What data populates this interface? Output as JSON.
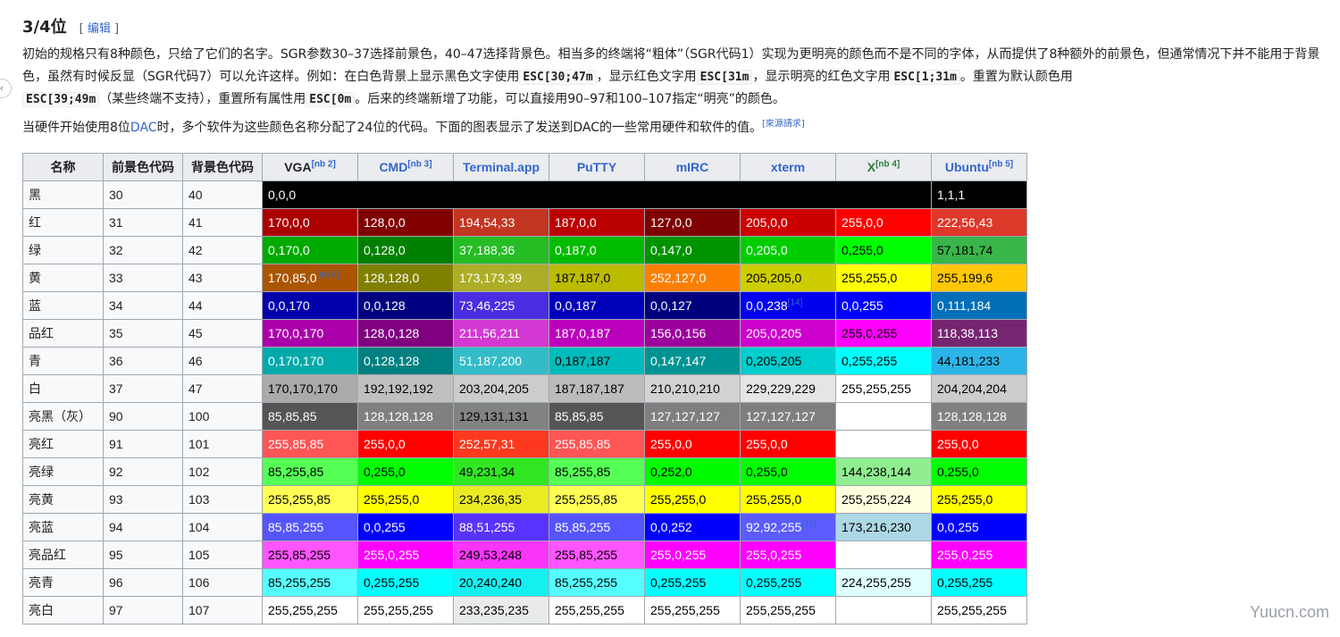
{
  "heading": {
    "title": "3/4位",
    "edit_open": "[",
    "edit_label": "编辑",
    "edit_close": "]"
  },
  "paragraph1": {
    "t1": "初始的规格只有8种颜色，只给了它们的名字。SGR参数30–37选择前景色，40–47选择背景色。相当多的终端将“粗体”（SGR代码1）实现为更明亮的颜色而不是不同的字体，从而提供了8种额外的前景色，但通常情况下并不能用于背景色，虽然有时候反显（SGR代码7）可以允许这样。例如：在白色背景上显示黑色文字使用",
    "c1": "ESC[30;47m",
    "t2": "，显示红色文字用",
    "c2": "ESC[31m",
    "t3": "，显示明亮的红色文字用",
    "c3": "ESC[1;31m",
    "t4": "。重置为默认颜色用",
    "c4": "ESC[39;49m",
    "t5": "（某些终端不支持），重置所有属性用",
    "c5": "ESC[0m",
    "t6": "。后来的终端新增了功能，可以直接用90–97和100–107指定“明亮”的颜色。"
  },
  "paragraph2": {
    "t1": "当硬件开始使用8位",
    "link": "DAC",
    "t2": "时，多个软件为这些颜色名称分配了24位的代码。下面的图表显示了发送到DAC的一些常用硬件和软件的值。",
    "ref": "[來源請求]"
  },
  "table": {
    "headers": [
      {
        "label": "名称",
        "note": "",
        "link": false
      },
      {
        "label": "前景色代码",
        "note": "",
        "link": false
      },
      {
        "label": "背景色代码",
        "note": "",
        "link": false
      },
      {
        "label": "VGA",
        "note": "[nb 2]",
        "link": false
      },
      {
        "label": "CMD",
        "note": "[nb 3]",
        "link": true
      },
      {
        "label": "Terminal.app",
        "note": "",
        "link": true
      },
      {
        "label": "PuTTY",
        "note": "",
        "link": true
      },
      {
        "label": "mIRC",
        "note": "",
        "link": true
      },
      {
        "label": "xterm",
        "note": "",
        "link": true
      },
      {
        "label": "X",
        "note": "[nb 4]",
        "link": true
      },
      {
        "label": "Ubuntu",
        "note": "[nb 5]",
        "link": true
      }
    ],
    "rows": [
      {
        "name": "黑",
        "fg": "30",
        "bg": "40",
        "cells": [
          {
            "text": "0,0,0",
            "bg": "#000000",
            "fg": "#ffffff",
            "span": 7
          },
          {
            "text": "1,1,1",
            "bg": "#010101",
            "fg": "#ffffff"
          }
        ]
      },
      {
        "name": "红",
        "fg": "31",
        "bg": "41",
        "cells": [
          {
            "text": "170,0,0",
            "bg": "#aa0000",
            "fg": "#ffffff"
          },
          {
            "text": "128,0,0",
            "bg": "#800000",
            "fg": "#ffffff"
          },
          {
            "text": "194,54,33",
            "bg": "#c23621",
            "fg": "#ffffff"
          },
          {
            "text": "187,0,0",
            "bg": "#bb0000",
            "fg": "#ffffff"
          },
          {
            "text": "127,0,0",
            "bg": "#7f0000",
            "fg": "#ffffff"
          },
          {
            "text": "205,0,0",
            "bg": "#cd0000",
            "fg": "#ffffff"
          },
          {
            "text": "255,0,0",
            "bg": "#ff0000",
            "fg": "#ffffff"
          },
          {
            "text": "222,56,43",
            "bg": "#de382b",
            "fg": "#ffffff"
          }
        ]
      },
      {
        "name": "绿",
        "fg": "32",
        "bg": "42",
        "cells": [
          {
            "text": "0,170,0",
            "bg": "#00aa00",
            "fg": "#ffffff"
          },
          {
            "text": "0,128,0",
            "bg": "#008000",
            "fg": "#ffffff"
          },
          {
            "text": "37,188,36",
            "bg": "#25bc24",
            "fg": "#ffffff"
          },
          {
            "text": "0,187,0",
            "bg": "#00bb00",
            "fg": "#ffffff"
          },
          {
            "text": "0,147,0",
            "bg": "#009300",
            "fg": "#ffffff"
          },
          {
            "text": "0,205,0",
            "bg": "#00cd00",
            "fg": "#ffffff"
          },
          {
            "text": "0,255,0",
            "bg": "#00ff00",
            "fg": "#000000"
          },
          {
            "text": "57,181,74",
            "bg": "#39b54a",
            "fg": "#000000"
          }
        ]
      },
      {
        "name": "黄",
        "fg": "33",
        "bg": "43",
        "cells": [
          {
            "text": "170,85,0",
            "bg": "#aa5500",
            "fg": "#ffffff",
            "note": "[nb 6]"
          },
          {
            "text": "128,128,0",
            "bg": "#808000",
            "fg": "#ffffff"
          },
          {
            "text": "173,173,39",
            "bg": "#adad27",
            "fg": "#ffffff"
          },
          {
            "text": "187,187,0",
            "bg": "#bbbb00",
            "fg": "#000000"
          },
          {
            "text": "252,127,0",
            "bg": "#fc7f00",
            "fg": "#ffffff"
          },
          {
            "text": "205,205,0",
            "bg": "#cdcd00",
            "fg": "#000000"
          },
          {
            "text": "255,255,0",
            "bg": "#ffff00",
            "fg": "#000000"
          },
          {
            "text": "255,199,6",
            "bg": "#ffc706",
            "fg": "#000000"
          }
        ]
      },
      {
        "name": "蓝",
        "fg": "34",
        "bg": "44",
        "cells": [
          {
            "text": "0,0,170",
            "bg": "#0000aa",
            "fg": "#ffffff"
          },
          {
            "text": "0,0,128",
            "bg": "#000080",
            "fg": "#ffffff"
          },
          {
            "text": "73,46,225",
            "bg": "#492ee1",
            "fg": "#ffffff"
          },
          {
            "text": "0,0,187",
            "bg": "#0000bb",
            "fg": "#ffffff"
          },
          {
            "text": "0,0,127",
            "bg": "#00007f",
            "fg": "#ffffff"
          },
          {
            "text": "0,0,238",
            "bg": "#0000ee",
            "fg": "#ffffff",
            "note": "[14]"
          },
          {
            "text": "0,0,255",
            "bg": "#0000ff",
            "fg": "#ffffff"
          },
          {
            "text": "0,111,184",
            "bg": "#006fb8",
            "fg": "#ffffff"
          }
        ]
      },
      {
        "name": "品红",
        "fg": "35",
        "bg": "45",
        "cells": [
          {
            "text": "170,0,170",
            "bg": "#aa00aa",
            "fg": "#ffffff"
          },
          {
            "text": "128,0,128",
            "bg": "#800080",
            "fg": "#ffffff"
          },
          {
            "text": "211,56,211",
            "bg": "#d338d3",
            "fg": "#ffffff"
          },
          {
            "text": "187,0,187",
            "bg": "#bb00bb",
            "fg": "#ffffff"
          },
          {
            "text": "156,0,156",
            "bg": "#9c009c",
            "fg": "#ffffff"
          },
          {
            "text": "205,0,205",
            "bg": "#cd00cd",
            "fg": "#ffffff"
          },
          {
            "text": "255,0,255",
            "bg": "#ff00ff",
            "fg": "#000000"
          },
          {
            "text": "118,38,113",
            "bg": "#762671",
            "fg": "#ffffff"
          }
        ]
      },
      {
        "name": "青",
        "fg": "36",
        "bg": "46",
        "cells": [
          {
            "text": "0,170,170",
            "bg": "#00aaaa",
            "fg": "#ffffff"
          },
          {
            "text": "0,128,128",
            "bg": "#008080",
            "fg": "#ffffff"
          },
          {
            "text": "51,187,200",
            "bg": "#33bbc8",
            "fg": "#ffffff"
          },
          {
            "text": "0,187,187",
            "bg": "#00bbbb",
            "fg": "#000000"
          },
          {
            "text": "0,147,147",
            "bg": "#009393",
            "fg": "#ffffff"
          },
          {
            "text": "0,205,205",
            "bg": "#00cdcd",
            "fg": "#000000"
          },
          {
            "text": "0,255,255",
            "bg": "#00ffff",
            "fg": "#000000"
          },
          {
            "text": "44,181,233",
            "bg": "#2cb5e9",
            "fg": "#000000"
          }
        ]
      },
      {
        "name": "白",
        "fg": "37",
        "bg": "47",
        "cells": [
          {
            "text": "170,170,170",
            "bg": "#aaaaaa",
            "fg": "#000000"
          },
          {
            "text": "192,192,192",
            "bg": "#c0c0c0",
            "fg": "#000000"
          },
          {
            "text": "203,204,205",
            "bg": "#cbcccd",
            "fg": "#000000"
          },
          {
            "text": "187,187,187",
            "bg": "#bbbbbb",
            "fg": "#000000"
          },
          {
            "text": "210,210,210",
            "bg": "#d2d2d2",
            "fg": "#000000"
          },
          {
            "text": "229,229,229",
            "bg": "#e5e5e5",
            "fg": "#000000"
          },
          {
            "text": "255,255,255",
            "bg": "#ffffff",
            "fg": "#000000"
          },
          {
            "text": "204,204,204",
            "bg": "#cccccc",
            "fg": "#000000"
          }
        ]
      },
      {
        "name": "亮黑（灰）",
        "fg": "90",
        "bg": "100",
        "cells": [
          {
            "text": "85,85,85",
            "bg": "#555555",
            "fg": "#ffffff"
          },
          {
            "text": "128,128,128",
            "bg": "#808080",
            "fg": "#ffffff"
          },
          {
            "text": "129,131,131",
            "bg": "#818383",
            "fg": "#000000"
          },
          {
            "text": "85,85,85",
            "bg": "#555555",
            "fg": "#ffffff"
          },
          {
            "text": "127,127,127",
            "bg": "#7f7f7f",
            "fg": "#ffffff"
          },
          {
            "text": "127,127,127",
            "bg": "#7f7f7f",
            "fg": "#ffffff"
          },
          {
            "text": "",
            "bg": "#ffffff",
            "fg": "#000000"
          },
          {
            "text": "128,128,128",
            "bg": "#808080",
            "fg": "#ffffff"
          }
        ]
      },
      {
        "name": "亮红",
        "fg": "91",
        "bg": "101",
        "cells": [
          {
            "text": "255,85,85",
            "bg": "#ff5555",
            "fg": "#ffffff"
          },
          {
            "text": "255,0,0",
            "bg": "#ff0000",
            "fg": "#ffffff"
          },
          {
            "text": "252,57,31",
            "bg": "#fc391f",
            "fg": "#ffffff"
          },
          {
            "text": "255,85,85",
            "bg": "#ff5555",
            "fg": "#ffffff"
          },
          {
            "text": "255,0,0",
            "bg": "#ff0000",
            "fg": "#ffffff"
          },
          {
            "text": "255,0,0",
            "bg": "#ff0000",
            "fg": "#ffffff"
          },
          {
            "text": "",
            "bg": "#ffffff",
            "fg": "#000000"
          },
          {
            "text": "255,0,0",
            "bg": "#ff0000",
            "fg": "#ffffff"
          }
        ]
      },
      {
        "name": "亮绿",
        "fg": "92",
        "bg": "102",
        "cells": [
          {
            "text": "85,255,85",
            "bg": "#55ff55",
            "fg": "#000000"
          },
          {
            "text": "0,255,0",
            "bg": "#00ff00",
            "fg": "#000000"
          },
          {
            "text": "49,231,34",
            "bg": "#31e722",
            "fg": "#000000"
          },
          {
            "text": "85,255,85",
            "bg": "#55ff55",
            "fg": "#000000"
          },
          {
            "text": "0,252,0",
            "bg": "#00fc00",
            "fg": "#000000"
          },
          {
            "text": "0,255,0",
            "bg": "#00ff00",
            "fg": "#000000"
          },
          {
            "text": "144,238,144",
            "bg": "#90ee90",
            "fg": "#000000"
          },
          {
            "text": "0,255,0",
            "bg": "#00ff00",
            "fg": "#000000"
          }
        ]
      },
      {
        "name": "亮黄",
        "fg": "93",
        "bg": "103",
        "cells": [
          {
            "text": "255,255,85",
            "bg": "#ffff55",
            "fg": "#000000"
          },
          {
            "text": "255,255,0",
            "bg": "#ffff00",
            "fg": "#000000"
          },
          {
            "text": "234,236,35",
            "bg": "#eaec23",
            "fg": "#000000"
          },
          {
            "text": "255,255,85",
            "bg": "#ffff55",
            "fg": "#000000"
          },
          {
            "text": "255,255,0",
            "bg": "#ffff00",
            "fg": "#000000"
          },
          {
            "text": "255,255,0",
            "bg": "#ffff00",
            "fg": "#000000"
          },
          {
            "text": "255,255,224",
            "bg": "#ffffe0",
            "fg": "#000000"
          },
          {
            "text": "255,255,0",
            "bg": "#ffff00",
            "fg": "#000000"
          }
        ]
      },
      {
        "name": "亮蓝",
        "fg": "94",
        "bg": "104",
        "cells": [
          {
            "text": "85,85,255",
            "bg": "#5555ff",
            "fg": "#ffffff"
          },
          {
            "text": "0,0,255",
            "bg": "#0000ff",
            "fg": "#ffffff"
          },
          {
            "text": "88,51,255",
            "bg": "#5833ff",
            "fg": "#ffffff"
          },
          {
            "text": "85,85,255",
            "bg": "#5555ff",
            "fg": "#ffffff"
          },
          {
            "text": "0,0,252",
            "bg": "#0000fc",
            "fg": "#ffffff"
          },
          {
            "text": "92,92,255",
            "bg": "#5c5cff",
            "fg": "#ffffff",
            "note": "[15]"
          },
          {
            "text": "173,216,230",
            "bg": "#add8e6",
            "fg": "#000000"
          },
          {
            "text": "0,0,255",
            "bg": "#0000ff",
            "fg": "#ffffff"
          }
        ]
      },
      {
        "name": "亮品红",
        "fg": "95",
        "bg": "105",
        "cells": [
          {
            "text": "255,85,255",
            "bg": "#ff55ff",
            "fg": "#000000"
          },
          {
            "text": "255,0,255",
            "bg": "#ff00ff",
            "fg": "#ffffff"
          },
          {
            "text": "249,53,248",
            "bg": "#f935f8",
            "fg": "#000000"
          },
          {
            "text": "255,85,255",
            "bg": "#ff55ff",
            "fg": "#000000"
          },
          {
            "text": "255,0,255",
            "bg": "#ff00ff",
            "fg": "#ffffff"
          },
          {
            "text": "255,0,255",
            "bg": "#ff00ff",
            "fg": "#ffffff"
          },
          {
            "text": "",
            "bg": "#ffffff",
            "fg": "#000000"
          },
          {
            "text": "255,0,255",
            "bg": "#ff00ff",
            "fg": "#ffffff"
          }
        ]
      },
      {
        "name": "亮青",
        "fg": "96",
        "bg": "106",
        "cells": [
          {
            "text": "85,255,255",
            "bg": "#55ffff",
            "fg": "#000000"
          },
          {
            "text": "0,255,255",
            "bg": "#00ffff",
            "fg": "#000000"
          },
          {
            "text": "20,240,240",
            "bg": "#14f0f0",
            "fg": "#000000"
          },
          {
            "text": "85,255,255",
            "bg": "#55ffff",
            "fg": "#000000"
          },
          {
            "text": "0,255,255",
            "bg": "#00ffff",
            "fg": "#000000"
          },
          {
            "text": "0,255,255",
            "bg": "#00ffff",
            "fg": "#000000"
          },
          {
            "text": "224,255,255",
            "bg": "#e0ffff",
            "fg": "#000000"
          },
          {
            "text": "0,255,255",
            "bg": "#00ffff",
            "fg": "#000000"
          }
        ]
      },
      {
        "name": "亮白",
        "fg": "97",
        "bg": "107",
        "cells": [
          {
            "text": "255,255,255",
            "bg": "#ffffff",
            "fg": "#000000"
          },
          {
            "text": "255,255,255",
            "bg": "#ffffff",
            "fg": "#000000"
          },
          {
            "text": "233,235,235",
            "bg": "#e9ebeb",
            "fg": "#000000"
          },
          {
            "text": "255,255,255",
            "bg": "#ffffff",
            "fg": "#000000"
          },
          {
            "text": "255,255,255",
            "bg": "#ffffff",
            "fg": "#000000"
          },
          {
            "text": "255,255,255",
            "bg": "#ffffff",
            "fg": "#000000"
          },
          {
            "text": "",
            "bg": "#ffffff",
            "fg": "#000000"
          },
          {
            "text": "255,255,255",
            "bg": "#ffffff",
            "fg": "#000000"
          }
        ]
      }
    ]
  },
  "side_tab": {
    "glyph": "‹"
  },
  "watermark": "Yuucn.com"
}
